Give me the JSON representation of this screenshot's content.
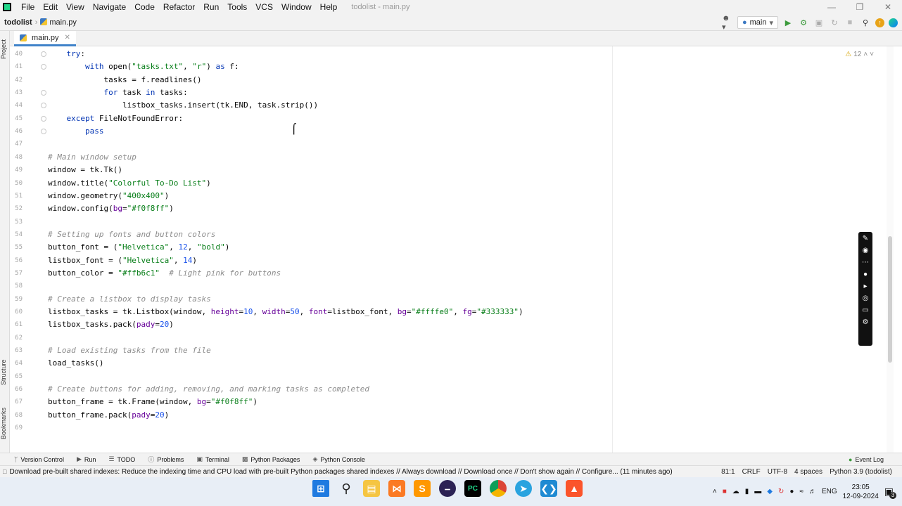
{
  "menubar": {
    "items": [
      "File",
      "Edit",
      "View",
      "Navigate",
      "Code",
      "Refactor",
      "Run",
      "Tools",
      "VCS",
      "Window",
      "Help"
    ],
    "window_title": "todolist - main.py"
  },
  "navbar": {
    "project": "todolist",
    "file": "main.py",
    "branch": "main"
  },
  "tab": {
    "label": "main.py"
  },
  "side_tabs": {
    "project": "Project",
    "structure": "Structure",
    "bookmarks": "Bookmarks"
  },
  "editor": {
    "warning_count": "12",
    "lines": [
      {
        "n": "40",
        "html": "    <span class='kw'>try</span>:"
      },
      {
        "n": "41",
        "html": "        <span class='kw'>with</span> open(<span class='str'>\"tasks.txt\"</span>, <span class='str'>\"r\"</span>) <span class='kw'>as</span> f:"
      },
      {
        "n": "42",
        "html": "            tasks = f.readlines()"
      },
      {
        "n": "43",
        "html": "            <span class='kw'>for</span> task <span class='kw'>in</span> tasks:"
      },
      {
        "n": "44",
        "html": "                listbox_tasks.insert(tk.END, task.strip())"
      },
      {
        "n": "45",
        "html": "    <span class='kw'>except</span> FileNotFoundError:"
      },
      {
        "n": "46",
        "html": "        <span class='kw'>pass</span>"
      },
      {
        "n": "47",
        "html": ""
      },
      {
        "n": "48",
        "html": "<span class='cmt'># Main window setup</span>"
      },
      {
        "n": "49",
        "html": "window = tk.Tk()"
      },
      {
        "n": "50",
        "html": "window.title(<span class='str'>\"Colorful To-Do List\"</span>)"
      },
      {
        "n": "51",
        "html": "window.geometry(<span class='str'>\"400x400\"</span>)"
      },
      {
        "n": "52",
        "html": "window.config(<span class='param'>bg</span>=<span class='str'>\"#f0f8ff\"</span>)"
      },
      {
        "n": "53",
        "html": ""
      },
      {
        "n": "54",
        "html": "<span class='cmt'># Setting up fonts and button colors</span>"
      },
      {
        "n": "55",
        "html": "button_font = (<span class='str'>\"Helvetica\"</span>, <span class='num'>12</span>, <span class='str'>\"bold\"</span>)"
      },
      {
        "n": "56",
        "html": "listbox_font = (<span class='str'>\"Helvetica\"</span>, <span class='num'>14</span>)"
      },
      {
        "n": "57",
        "html": "button_color = <span class='str'>\"#ffb6c1\"</span>  <span class='cmt'># Light pink for buttons</span>"
      },
      {
        "n": "58",
        "html": ""
      },
      {
        "n": "59",
        "html": "<span class='cmt'># Create a listbox to display tasks</span>"
      },
      {
        "n": "60",
        "html": "listbox_tasks = tk.Listbox(window, <span class='param'>height</span>=<span class='num'>10</span>, <span class='param'>width</span>=<span class='num'>50</span>, <span class='param'>font</span>=listbox_font, <span class='param'>bg</span>=<span class='str'>\"#ffffe0\"</span>, <span class='param'>fg</span>=<span class='str'>\"#333333\"</span>)"
      },
      {
        "n": "61",
        "html": "listbox_tasks.pack(<span class='param'>pady</span>=<span class='num'>20</span>)"
      },
      {
        "n": "62",
        "html": ""
      },
      {
        "n": "63",
        "html": "<span class='cmt'># Load existing tasks from the file</span>"
      },
      {
        "n": "64",
        "html": "load_tasks()"
      },
      {
        "n": "65",
        "html": ""
      },
      {
        "n": "66",
        "html": "<span class='cmt'># Create buttons for adding, removing, and marking tasks as completed</span>"
      },
      {
        "n": "67",
        "html": "button_frame = tk.Frame(window, <span class='param'>bg</span>=<span class='str'>\"#f0f8ff\"</span>)"
      },
      {
        "n": "68",
        "html": "button_frame.pack(<span class='param'>pady</span>=<span class='num'>20</span>)"
      },
      {
        "n": "69",
        "html": ""
      }
    ]
  },
  "toolwindows": [
    "Version Control",
    "Run",
    "TODO",
    "Problems",
    "Terminal",
    "Python Packages",
    "Python Console"
  ],
  "event_log": "Event Log",
  "status": {
    "message": "Download pre-built shared indexes: Reduce the indexing time and CPU load with pre-built Python packages shared indexes // Always download // Download once // Don't show again // Configure... (11 minutes ago)",
    "position": "81:1",
    "line_sep": "CRLF",
    "encoding": "UTF-8",
    "indent": "4 spaces",
    "interpreter": "Python 3.9 (todolist)"
  },
  "taskbar": {
    "lang": "ENG",
    "time": "23:05",
    "date": "12-09-2024",
    "notif_count": "3"
  }
}
